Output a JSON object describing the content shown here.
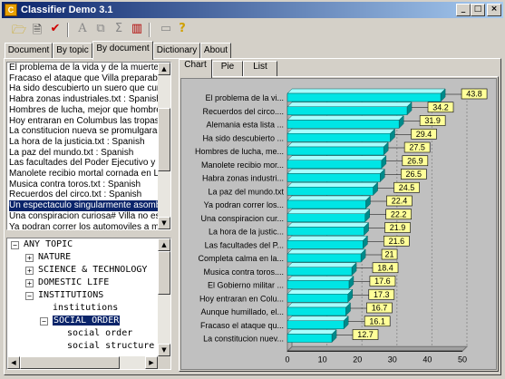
{
  "window": {
    "title": "Classifier Demo 3.1",
    "app_icon": "C",
    "controls": [
      "_",
      "□",
      "×"
    ]
  },
  "toolbar": {
    "icons": [
      "open-folder-icon",
      "open-document-icon",
      "check-icon",
      "font-icon",
      "copy-icon",
      "sigma-icon",
      "chart-icon",
      "camera-icon",
      "help-icon"
    ]
  },
  "tabs": [
    "Document",
    "By topic",
    "By document",
    "Dictionary",
    "About"
  ],
  "active_tab": "By document",
  "documents": [
    "El problema de la vida y de la muerte.txt",
    "Fracaso el ataque que Villa preparaba c",
    "Ha sido descubierto un suero que cura",
    "Habra zonas industriales.txt : Spanish",
    "Hombres de lucha, mejor que hombres",
    "Hoy entraran en Columbus las tropas de",
    "La constitucion nueva se promulgara h",
    "La hora de la justicia.txt : Spanish",
    "La paz del mundo.txt : Spanish",
    "Las facultades del Poder Ejecutivo y la",
    "Manolete recibio mortal cornada en Lin",
    "Musica contra toros.txt : Spanish",
    "Recuerdos del circo.txt : Spanish",
    "Un espectaculo singularmente asombro",
    "Una conspiracion curiosa# Villa no es r",
    "Ya podran correr los automoviles a may"
  ],
  "selected_document_index": 13,
  "topic_tree": [
    {
      "label": "ANY TOPIC",
      "level": 0,
      "expander": "−"
    },
    {
      "label": "NATURE",
      "level": 1,
      "expander": "+"
    },
    {
      "label": "SCIENCE & TECHNOLOGY",
      "level": 1,
      "expander": "+"
    },
    {
      "label": "DOMESTIC LIFE",
      "level": 1,
      "expander": "+"
    },
    {
      "label": "INSTITUTIONS",
      "level": 1,
      "expander": "−"
    },
    {
      "label": "institutions",
      "level": 2,
      "expander": ""
    },
    {
      "label": "SOCIAL ORDER",
      "level": 2,
      "expander": "−",
      "selected": true
    },
    {
      "label": "social order",
      "level": 3,
      "expander": ""
    },
    {
      "label": "social structure and co",
      "level": 3,
      "expander": ""
    }
  ],
  "inner_tabs": [
    "Chart",
    "Pie",
    "List"
  ],
  "active_inner_tab": "Chart",
  "colors": {
    "bar_face": "#00e5e5",
    "bar_top": "#a8ffff",
    "bar_side": "#008a8a",
    "value_label_bg": "#ffff99",
    "selection": "#0a246a"
  },
  "chart_data": {
    "type": "bar",
    "orientation": "horizontal",
    "categories": [
      "El problema de la vi...",
      "Recuerdos del circo....",
      "Alemania esta lista ...",
      "Ha sido descubierto ...",
      "Hombres de lucha, me...",
      "Manolete recibio mor...",
      "Habra zonas industri...",
      "La paz del mundo.txt",
      "Ya podran correr los...",
      "Una conspiracion cur...",
      "La hora de la justic...",
      "Las facultades del P...",
      "Completa calma en la...",
      "Musica contra toros....",
      "El Gobierno militar ...",
      "Hoy entraran en Colu...",
      "Aunque humillado, el...",
      "Fracaso el ataque qu...",
      "La constitucion nuev..."
    ],
    "values": [
      43.8,
      34.2,
      31.9,
      29.4,
      27.5,
      26.9,
      26.5,
      24.5,
      22.4,
      22.2,
      21.9,
      21.6,
      21,
      18.4,
      17.6,
      17.3,
      16.7,
      16.1,
      12.7
    ],
    "value_labels": [
      "43.8",
      "34.2",
      "31.9",
      "29.4",
      "27.5",
      "26.9",
      "26.5",
      "24.5",
      "22.4",
      "22.2",
      "21.9",
      "21.6",
      "21",
      "18.4",
      "17.6",
      "17.3",
      "16.7",
      "16.1",
      "12.7"
    ],
    "xlim": [
      0,
      50
    ],
    "x_ticks": [
      "0",
      "10",
      "20",
      "30",
      "40",
      "50"
    ],
    "grid": true,
    "style": "3d"
  }
}
